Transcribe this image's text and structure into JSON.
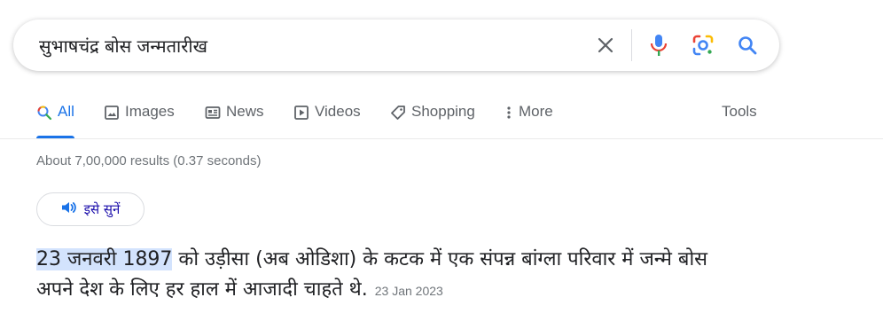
{
  "search": {
    "query": "सुभाषचंद्र बोस जन्मतारीख"
  },
  "tabs": [
    {
      "label": "All",
      "icon": "search-icon"
    },
    {
      "label": "Images",
      "icon": "image-icon"
    },
    {
      "label": "News",
      "icon": "news-icon"
    },
    {
      "label": "Videos",
      "icon": "video-icon"
    },
    {
      "label": "Shopping",
      "icon": "tag-icon"
    },
    {
      "label": "More",
      "icon": "more-vert-icon"
    }
  ],
  "tools_label": "Tools",
  "results_stats": "About 7,00,000 results (0.37 seconds)",
  "listen_label": "इसे सुनें",
  "snippet": {
    "highlight": "23 जनवरी 1897",
    "rest": " को उड़ीसा (अब ओडिशा) के कटक में एक संपन्न बांग्ला परिवार में जन्मे बोस अपने देश के लिए हर हाल में आजादी चाहते थे.",
    "date": "23 Jan 2023"
  },
  "colors": {
    "accent": "#1a73e8",
    "highlight": "#d3e3fd",
    "link": "#1a0dab"
  }
}
